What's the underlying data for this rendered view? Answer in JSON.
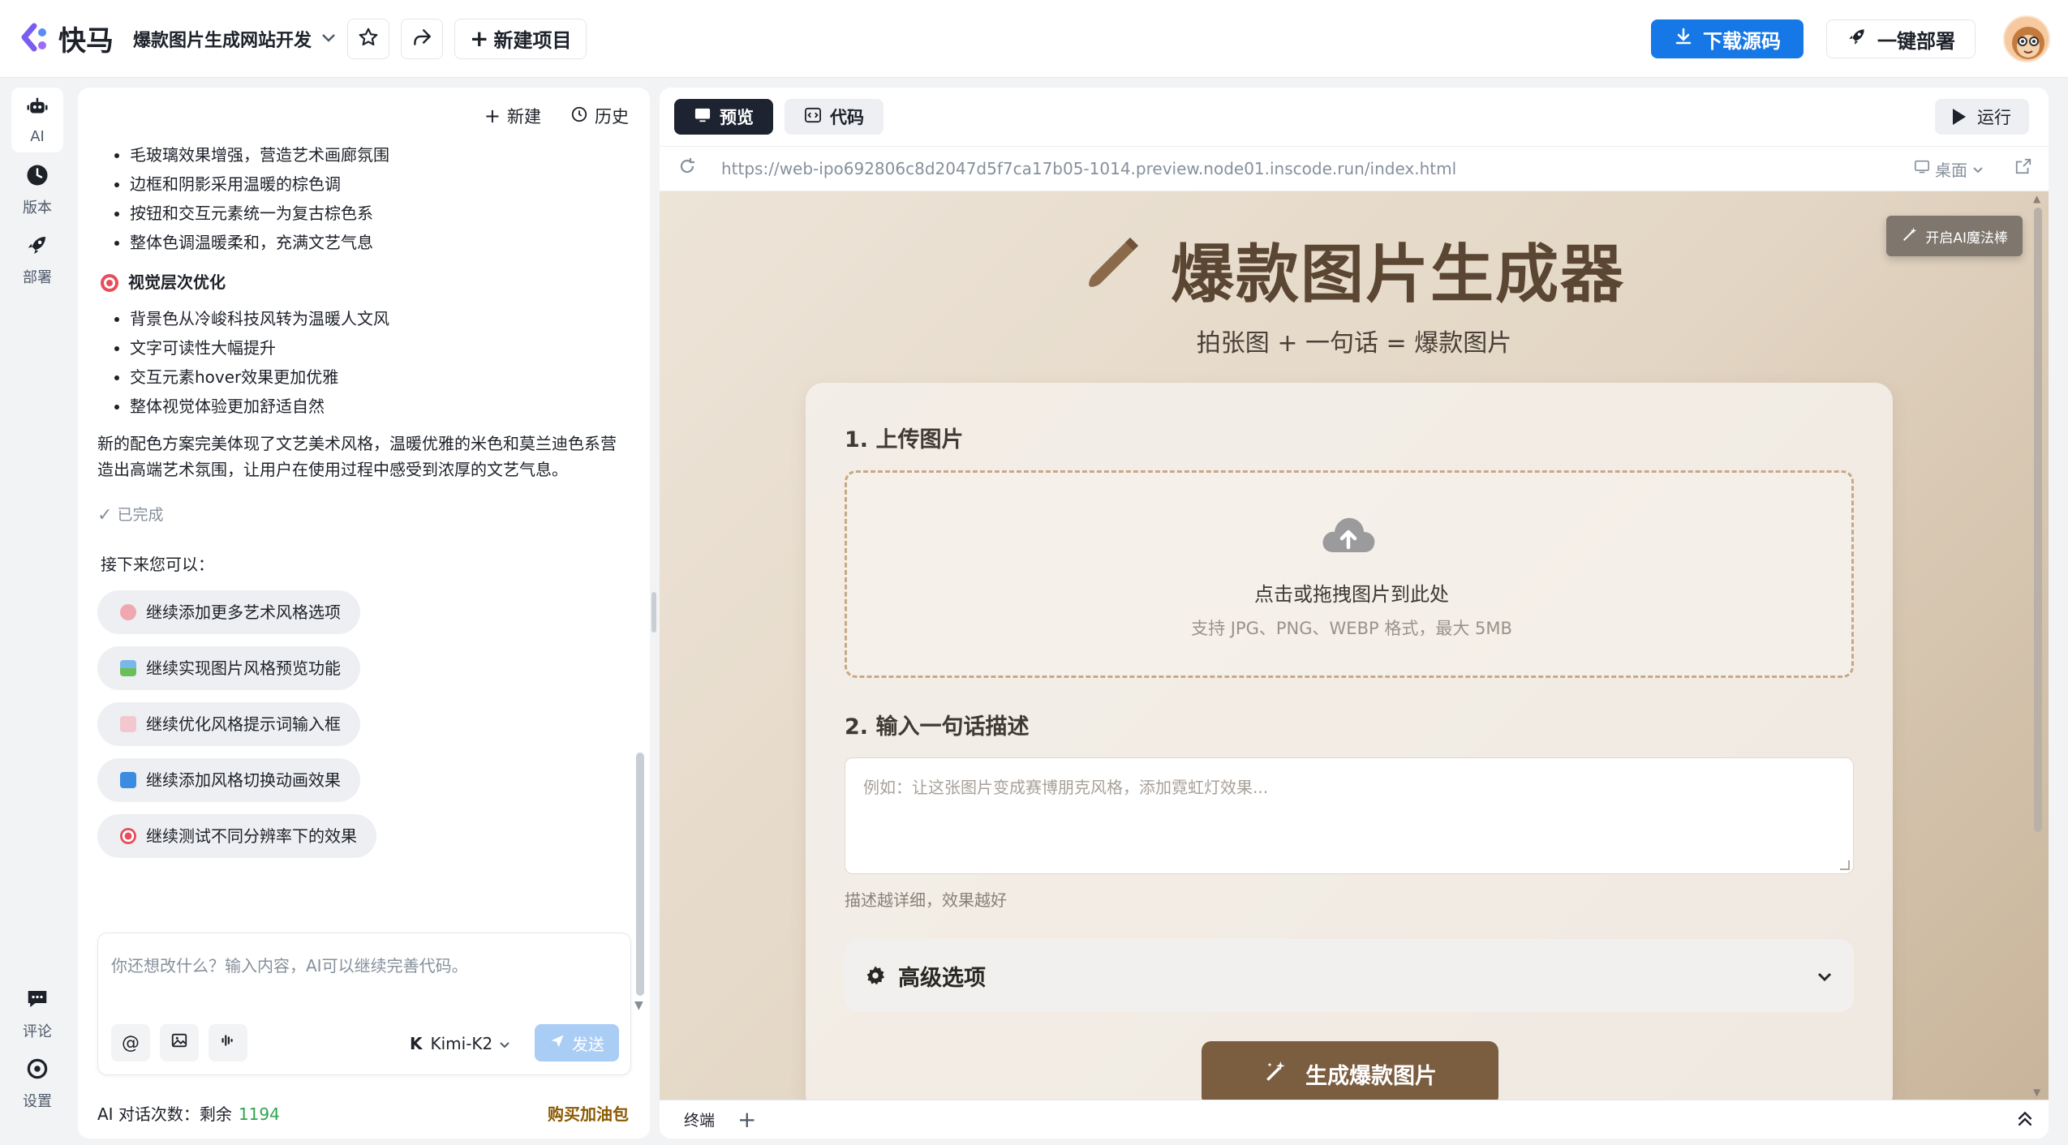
{
  "app": {
    "logo_text": "快马",
    "project_title": "爆款图片生成网站开发"
  },
  "toolbar": {
    "new_project": "新建项目",
    "download": "下载源码",
    "deploy": "一键部署",
    "accent": "#1677e6"
  },
  "rail": {
    "items": [
      {
        "label": "AI",
        "icon": "robot-icon"
      },
      {
        "label": "版本",
        "icon": "clock-icon"
      },
      {
        "label": "部署",
        "icon": "rocket-icon"
      }
    ],
    "bottom": [
      {
        "label": "评论",
        "icon": "comment-icon"
      },
      {
        "label": "设置",
        "icon": "settings-icon"
      }
    ]
  },
  "chat": {
    "header": {
      "new": "新建",
      "history": "历史"
    },
    "list1": [
      "毛玻璃效果增强，营造艺术画廊氛围",
      "边框和阴影采用温暖的棕色调",
      "按钮和交互元素统一为复古棕色系",
      "整体色调温暖柔和，充满文艺气息"
    ],
    "section_title": "视觉层次优化",
    "list2": [
      "背景色从冷峻科技风转为温暖人文风",
      "文字可读性大幅提升",
      "交互元素hover效果更加优雅",
      "整体视觉体验更加舒适自然"
    ],
    "paragraph": "新的配色方案完美体现了文艺美术风格，温暖优雅的米色和莫兰迪色系营造出高端艺术氛围，让用户在使用过程中感受到浓厚的文艺气息。",
    "done": "已完成",
    "next_title": "接下来您可以：",
    "suggestions": [
      "继续添加更多艺术风格选项",
      "继续实现图片风格预览功能",
      "继续优化风格提示词输入框",
      "继续添加风格切换动画效果",
      "继续测试不同分辨率下的效果"
    ],
    "input_placeholder": "你还想改什么？输入内容，AI可以继续完善代码。",
    "model": "Kimi-K2",
    "send": "发送",
    "quota_label": "AI 对话次数：剩余",
    "quota_value": "1194",
    "buy": "购买加油包"
  },
  "preview": {
    "tab_preview": "预览",
    "tab_code": "代码",
    "run": "运行",
    "url": "https://web-ipo692806c8d2047d5f7ca17b05-1014.preview.node01.inscode.run/index.html",
    "device": "桌面",
    "magic": "开启AI魔法棒",
    "title": "爆款图片生成器",
    "subtitle": "拍张图 + 一句话 = 爆款图片",
    "step1": "1. 上传图片",
    "upload_main": "点击或拖拽图片到此处",
    "upload_sub": "支持 JPG、PNG、WEBP 格式，最大 5MB",
    "step2": "2. 输入一句话描述",
    "desc_placeholder": "例如：让这张图片变成赛博朋克风格，添加霓虹灯效果...",
    "hint": "描述越详细，效果越好",
    "advanced": "高级选项",
    "generate": "生成爆款图片",
    "terminal": "终端"
  }
}
